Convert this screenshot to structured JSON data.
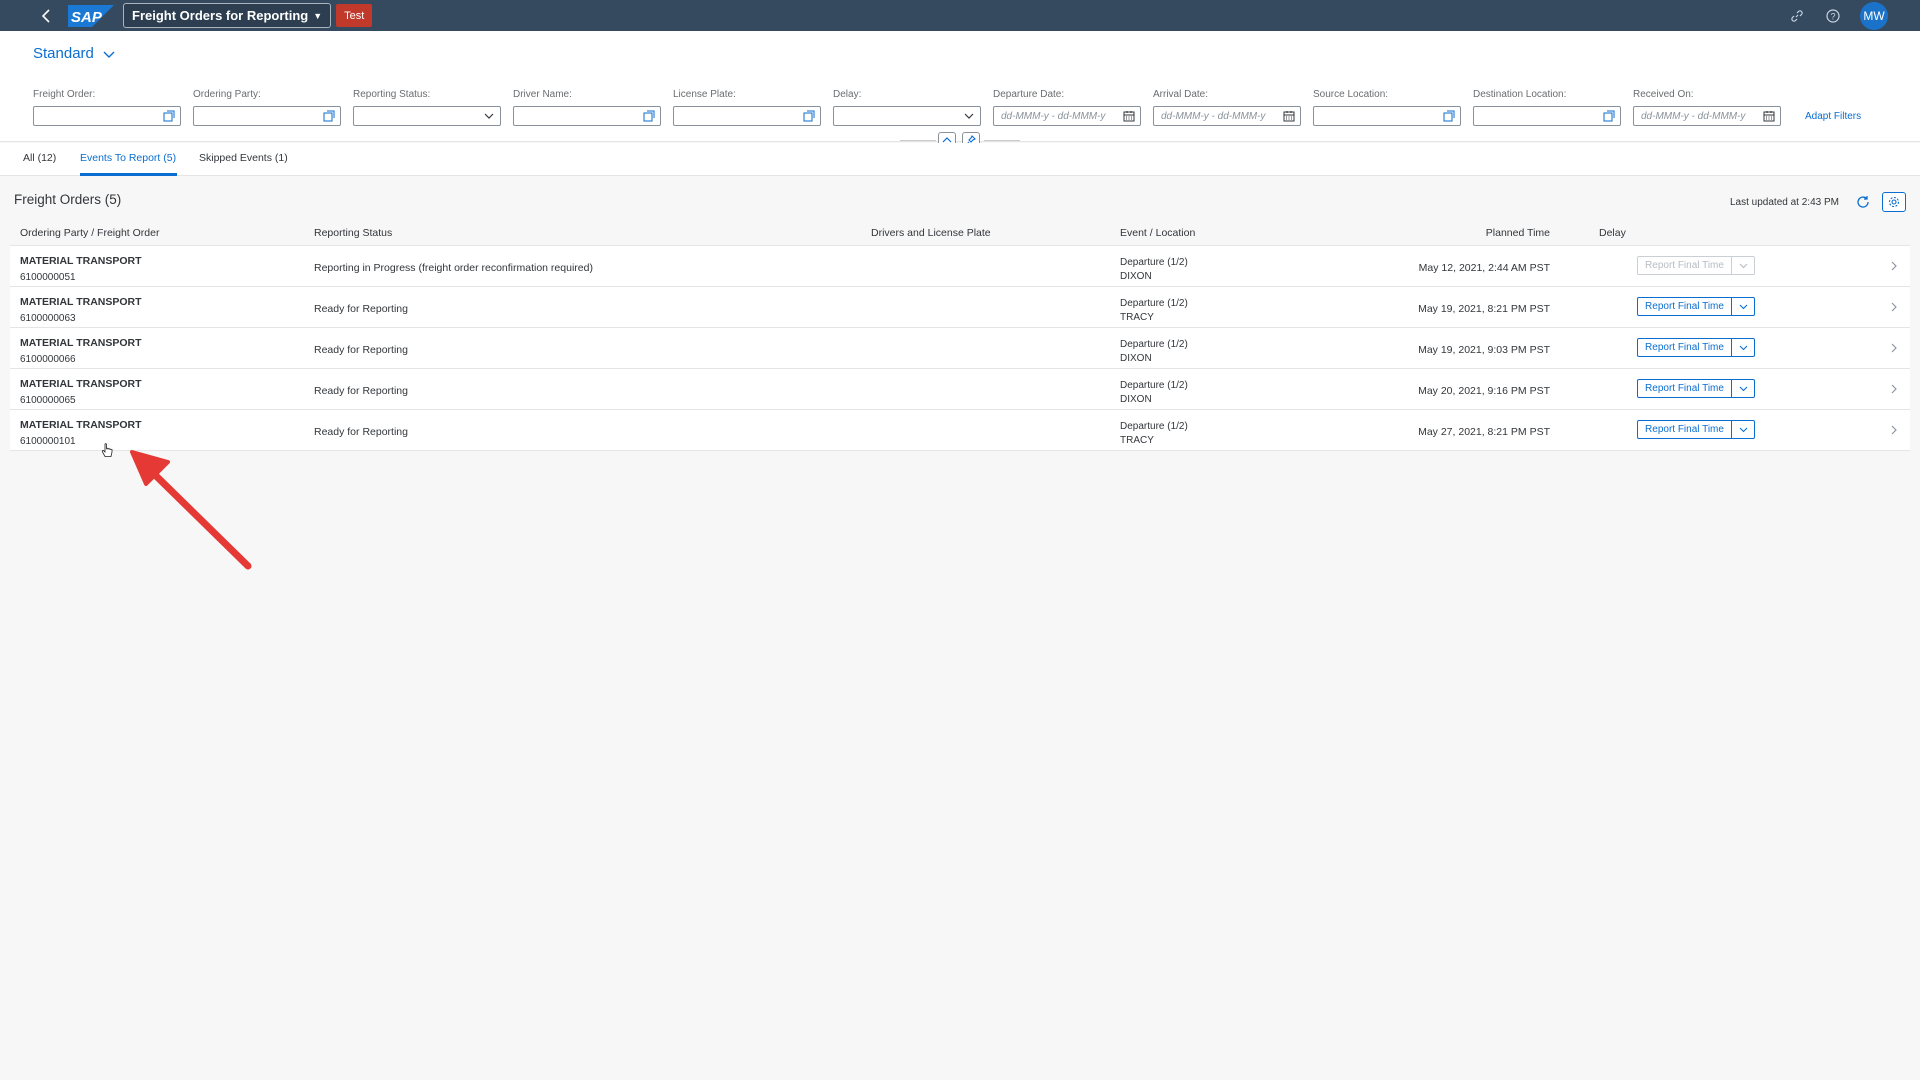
{
  "shell": {
    "logo_text": "SAP",
    "app_title": "Freight Orders for Reporting",
    "env_badge": "Test",
    "avatar_initials": "MW"
  },
  "filterbar": {
    "variant": "Standard",
    "filters": [
      {
        "label": "Freight Order:",
        "placeholder": "",
        "icon": "value-help-icon"
      },
      {
        "label": "Ordering Party:",
        "placeholder": "",
        "icon": "value-help-icon"
      },
      {
        "label": "Reporting Status:",
        "placeholder": "",
        "icon": "chevron-down-icon"
      },
      {
        "label": "Driver Name:",
        "placeholder": "",
        "icon": "value-help-icon"
      },
      {
        "label": "License Plate:",
        "placeholder": "",
        "icon": "value-help-icon"
      },
      {
        "label": "Delay:",
        "placeholder": "",
        "icon": "chevron-down-icon"
      },
      {
        "label": "Departure Date:",
        "placeholder": "dd-MMM-y - dd-MMM-y",
        "icon": "calendar-icon"
      },
      {
        "label": "Arrival Date:",
        "placeholder": "dd-MMM-y - dd-MMM-y",
        "icon": "calendar-icon"
      },
      {
        "label": "Source Location:",
        "placeholder": "",
        "icon": "value-help-icon"
      },
      {
        "label": "Destination Location:",
        "placeholder": "",
        "icon": "value-help-icon"
      },
      {
        "label": "Received On:",
        "placeholder": "dd-MMM-y - dd-MMM-y",
        "icon": "calendar-icon"
      }
    ],
    "adapt_filters": "Adapt Filters"
  },
  "tabs": [
    {
      "label": "All (12)"
    },
    {
      "label": "Events To Report (5)"
    },
    {
      "label": "Skipped Events (1)"
    }
  ],
  "table": {
    "title": "Freight Orders (5)",
    "last_updated": "Last updated at 2:43 PM",
    "columns": [
      "Ordering Party / Freight Order",
      "Reporting Status",
      "Drivers and License Plate",
      "Event / Location",
      "Planned Time",
      "Delay"
    ],
    "action_label": "Report Final Time",
    "rows": [
      {
        "party": "MATERIAL TRANSPORT",
        "order": "6100000051",
        "status": "Reporting in Progress (freight order reconfirmation required)",
        "event": "Departure (1/2)",
        "location": "DIXON",
        "planned": "May 12, 2021, 2:44 AM PST",
        "action_enabled": false
      },
      {
        "party": "MATERIAL TRANSPORT",
        "order": "6100000063",
        "status": "Ready for Reporting",
        "event": "Departure (1/2)",
        "location": "TRACY",
        "planned": "May 19, 2021, 8:21 PM PST",
        "action_enabled": true
      },
      {
        "party": "MATERIAL TRANSPORT",
        "order": "6100000066",
        "status": "Ready for Reporting",
        "event": "Departure (1/2)",
        "location": "DIXON",
        "planned": "May 19, 2021, 9:03 PM PST",
        "action_enabled": true
      },
      {
        "party": "MATERIAL TRANSPORT",
        "order": "6100000065",
        "status": "Ready for Reporting",
        "event": "Departure (1/2)",
        "location": "DIXON",
        "planned": "May 20, 2021, 9:16 PM PST",
        "action_enabled": true
      },
      {
        "party": "MATERIAL TRANSPORT",
        "order": "6100000101",
        "status": "Ready for Reporting",
        "event": "Departure (1/2)",
        "location": "TRACY",
        "planned": "May 27, 2021, 8:21 PM PST",
        "action_enabled": true
      }
    ]
  },
  "colors": {
    "shell": "#354a5f",
    "accent": "#0a6ed1",
    "badge": "#c0392b",
    "annotation_arrow": "#e53935"
  }
}
